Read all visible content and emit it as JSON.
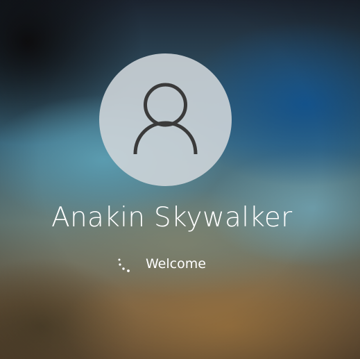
{
  "screen": {
    "type": "lock-screen-sign-in"
  },
  "user": {
    "avatar_icon": "user-avatar-icon",
    "name": "Anakin Skywalker"
  },
  "status": {
    "icon": "loading-spinner-icon",
    "text": "Welcome"
  },
  "colors": {
    "text": "#ffffff",
    "avatar_bg": "#cdd4d8",
    "avatar_icon": "#3a3a3a"
  }
}
